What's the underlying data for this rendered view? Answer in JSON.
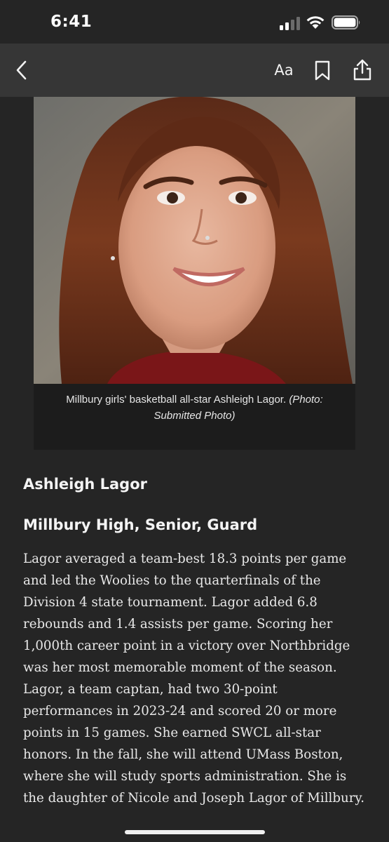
{
  "status": {
    "time": "6:41",
    "signal_icon": "cellular-signal-icon",
    "wifi_icon": "wifi-icon",
    "battery_icon": "battery-icon"
  },
  "toolbar": {
    "back_icon": "chevron-left-icon",
    "text_size_label": "Aa",
    "bookmark_icon": "bookmark-icon",
    "share_icon": "share-icon"
  },
  "photo": {
    "caption": "Millbury girls' basketball all-star Ashleigh Lagor.",
    "credit": "(Photo: Submitted Photo)"
  },
  "article": {
    "name": "Ashleigh Lagor",
    "subhead": "Millbury High, Senior, Guard",
    "body": "Lagor averaged a team-best 18.3 points per game and led the Woolies to the quarterfinals of the Division 4 state tournament. Lagor added 6.8 rebounds and 1.4 assists per game. Scoring her 1,000th career point in a victory over Northbridge was her most memorable moment of the season. Lagor, a team captan, had two 30-point performances in 2023-24 and scored 20 or more points in 15 games. She earned SWCL all-star honors. In the fall, she will attend UMass Boston, where she will study sports administration. She is the daughter of Nicole and Joseph Lagor of Millbury."
  },
  "colors": {
    "background": "#252525",
    "toolbar": "#363636",
    "caption_bg": "#1c1c1c",
    "text": "#ededed"
  }
}
